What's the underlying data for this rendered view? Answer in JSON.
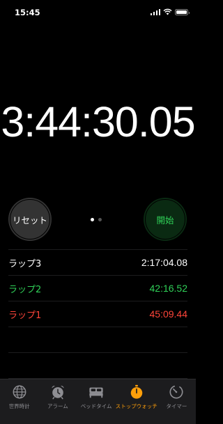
{
  "status_bar": {
    "time": "15:45"
  },
  "stopwatch": {
    "elapsed": "3:44:30.05"
  },
  "controls": {
    "reset_label": "リセット",
    "start_label": "開始"
  },
  "colors": {
    "accent": "#ff9f0a",
    "green": "#30d158",
    "red": "#ff453a"
  },
  "laps": [
    {
      "label": "ラップ3",
      "time": "2:17:04.08",
      "status": "normal"
    },
    {
      "label": "ラップ2",
      "time": "42:16.52",
      "status": "fastest"
    },
    {
      "label": "ラップ1",
      "time": "45:09.44",
      "status": "slowest"
    }
  ],
  "tabs": [
    {
      "label": "世界時計",
      "icon": "globe-icon"
    },
    {
      "label": "アラーム",
      "icon": "alarm-clock-icon"
    },
    {
      "label": "ベッドタイム",
      "icon": "bed-icon"
    },
    {
      "label": "ストップウォッチ",
      "icon": "stopwatch-icon",
      "active": true
    },
    {
      "label": "タイマー",
      "icon": "timer-icon"
    }
  ]
}
